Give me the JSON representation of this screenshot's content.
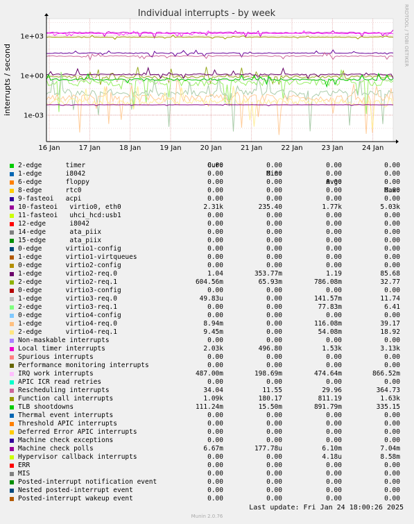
{
  "chart_data": {
    "type": "line",
    "title": "Individual interrupts - by week",
    "ylabel": "interrupts / second",
    "yscale": "log",
    "yticks": [
      "1e-03",
      "1e+00",
      "1e+03"
    ],
    "ylim": [
      1e-05,
      20000
    ],
    "x_ticks": [
      "16 Jan",
      "17 Jan",
      "18 Jan",
      "19 Jan",
      "20 Jan",
      "21 Jan",
      "22 Jan",
      "23 Jan",
      "24 Jan"
    ],
    "grid": true,
    "series": [
      {
        "name": "10-fasteoi virtio0, eth0",
        "color": "#cc00cc",
        "level": 1770,
        "low": 600,
        "high": 3000
      },
      {
        "name": "Local timer interrupts",
        "color": "#ff33ff",
        "level": 1530,
        "low": 900,
        "high": 2500
      },
      {
        "name": "Function call interrupts",
        "color": "#999900",
        "level": 811,
        "low": 500,
        "high": 1200
      },
      {
        "name": "TLB shootdowns",
        "color": "#660099",
        "level": 50,
        "low": 25,
        "high": 90
      },
      {
        "name": "Rescheduling interrupts",
        "color": "#cc6699",
        "level": 30,
        "low": 15,
        "high": 60
      },
      {
        "name": "2-edge virtio2-req.1",
        "color": "#99aa22",
        "level": 0.786,
        "low": 0.2,
        "high": 6
      },
      {
        "name": "1-edge virtio2-req.0",
        "color": "#660066",
        "level": 1.19,
        "low": 0.6,
        "high": 4
      },
      {
        "name": "2-edge virtio3-req.1",
        "color": "#99ee66",
        "level": 0.3,
        "low": 0.0001,
        "high": 3
      },
      {
        "name": "1-edge virtio3-req.0",
        "color": "#aaccaa",
        "level": 0.05,
        "low": 5e-05,
        "high": 2
      },
      {
        "name": "1-edge virtio4-req.0",
        "color": "#ffcc99",
        "level": 0.02,
        "low": 3e-05,
        "high": 1
      },
      {
        "name": "2-edge virtio4-req.1",
        "color": "#ffee99",
        "level": 0.01,
        "low": 3e-05,
        "high": 1
      },
      {
        "name": "Machine check polls",
        "color": "#880088",
        "level": 0.0061,
        "low": 0.005,
        "high": 0.007
      },
      {
        "name": "IRQ work interrupts",
        "color": "#ffccff",
        "level": 0.47,
        "low": 0.2,
        "high": 0.86
      },
      {
        "name": "2-edge timer",
        "color": "#00cc00",
        "level": 0.5,
        "low": 0.1,
        "high": 1.5
      }
    ]
  },
  "side_label": "RRDTOOL / TOBI OETIKER",
  "legend": {
    "headers": [
      "Cur:",
      "Min:",
      "Avg:",
      "Max:"
    ],
    "rows": [
      {
        "name": "2-edge      timer",
        "color": "#00cc00",
        "cur": "0.00",
        "min": "0.00",
        "avg": "0.00",
        "max": "0.00"
      },
      {
        "name": "1-edge      i8042",
        "color": "#0066b3",
        "cur": "0.00",
        "min": "0.00",
        "avg": "0.00",
        "max": "0.00"
      },
      {
        "name": "6-edge      floppy",
        "color": "#ff8000",
        "cur": "0.00",
        "min": "0.00",
        "avg": "0.00",
        "max": "0.00"
      },
      {
        "name": "8-edge      rtc0",
        "color": "#ffcc00",
        "cur": "0.00",
        "min": "0.00",
        "avg": "0.00",
        "max": "0.00"
      },
      {
        "name": "9-fasteoi   acpi",
        "color": "#330099",
        "cur": "0.00",
        "min": "0.00",
        "avg": "0.00",
        "max": "0.00"
      },
      {
        "name": "10-fasteoi   virtio0, eth0",
        "color": "#990099",
        "cur": "2.31k",
        "min": "235.40",
        "avg": "1.77k",
        "max": "5.03k"
      },
      {
        "name": "11-fasteoi   uhci_hcd:usb1",
        "color": "#ccff00",
        "cur": "0.00",
        "min": "0.00",
        "avg": "0.00",
        "max": "0.00"
      },
      {
        "name": "12-edge      i8042",
        "color": "#ff0000",
        "cur": "0.00",
        "min": "0.00",
        "avg": "0.00",
        "max": "0.00"
      },
      {
        "name": "14-edge      ata_piix",
        "color": "#808080",
        "cur": "0.00",
        "min": "0.00",
        "avg": "0.00",
        "max": "0.00"
      },
      {
        "name": "15-edge      ata_piix",
        "color": "#008f00",
        "cur": "0.00",
        "min": "0.00",
        "avg": "0.00",
        "max": "0.00"
      },
      {
        "name": "0-edge      virtio1-config",
        "color": "#00487d",
        "cur": "0.00",
        "min": "0.00",
        "avg": "0.00",
        "max": "0.00"
      },
      {
        "name": "1-edge      virtio1-virtqueues",
        "color": "#b35a00",
        "cur": "0.00",
        "min": "0.00",
        "avg": "0.00",
        "max": "0.00"
      },
      {
        "name": "0-edge      virtio2-config",
        "color": "#b38f00",
        "cur": "0.00",
        "min": "0.00",
        "avg": "0.00",
        "max": "0.00"
      },
      {
        "name": "1-edge      virtio2-req.0",
        "color": "#6b006b",
        "cur": "1.04",
        "min": "353.77m",
        "avg": "1.19",
        "max": "85.68"
      },
      {
        "name": "2-edge      virtio2-req.1",
        "color": "#8fb300",
        "cur": "604.56m",
        "min": "65.93m",
        "avg": "786.08m",
        "max": "32.77"
      },
      {
        "name": "0-edge      virtio3-config",
        "color": "#b30000",
        "cur": "0.00",
        "min": "0.00",
        "avg": "0.00",
        "max": "0.00"
      },
      {
        "name": "1-edge      virtio3-req.0",
        "color": "#bebebe",
        "cur": "49.83u",
        "min": "0.00",
        "avg": "141.57m",
        "max": "11.74"
      },
      {
        "name": "2-edge      virtio3-req.1",
        "color": "#80ff80",
        "cur": "0.00",
        "min": "0.00",
        "avg": "77.83m",
        "max": "6.41"
      },
      {
        "name": "0-edge      virtio4-config",
        "color": "#80c9ff",
        "cur": "0.00",
        "min": "0.00",
        "avg": "0.00",
        "max": "0.00"
      },
      {
        "name": "1-edge      virtio4-req.0",
        "color": "#ffc080",
        "cur": "8.94m",
        "min": "0.00",
        "avg": "116.08m",
        "max": "39.17"
      },
      {
        "name": "2-edge      virtio4-req.1",
        "color": "#ffe680",
        "cur": "9.45m",
        "min": "0.00",
        "avg": "54.08m",
        "max": "18.92"
      },
      {
        "name": "Non-maskable interrupts",
        "color": "#aa80ff",
        "cur": "0.00",
        "min": "0.00",
        "avg": "0.00",
        "max": "0.00"
      },
      {
        "name": "Local timer interrupts",
        "color": "#ee00cc",
        "cur": "2.03k",
        "min": "496.80",
        "avg": "1.53k",
        "max": "3.13k"
      },
      {
        "name": "Spurious interrupts",
        "color": "#ff8080",
        "cur": "0.00",
        "min": "0.00",
        "avg": "0.00",
        "max": "0.00"
      },
      {
        "name": "Performance monitoring interrupts",
        "color": "#666600",
        "cur": "0.00",
        "min": "0.00",
        "avg": "0.00",
        "max": "0.00"
      },
      {
        "name": "IRQ work interrupts",
        "color": "#ffbfff",
        "cur": "487.00m",
        "min": "198.69m",
        "avg": "474.64m",
        "max": "866.52m"
      },
      {
        "name": "APIC ICR read retries",
        "color": "#00ffcc",
        "cur": "0.00",
        "min": "0.00",
        "avg": "0.00",
        "max": "0.00"
      },
      {
        "name": "Rescheduling interrupts",
        "color": "#cc6699",
        "cur": "34.04",
        "min": "11.55",
        "avg": "29.96",
        "max": "364.73"
      },
      {
        "name": "Function call interrupts",
        "color": "#999900",
        "cur": "1.09k",
        "min": "180.17",
        "avg": "811.19",
        "max": "1.63k"
      },
      {
        "name": "TLB shootdowns",
        "color": "#00cc00",
        "cur": "111.24m",
        "min": "15.50m",
        "avg": "891.79m",
        "max": "335.15"
      },
      {
        "name": "Thermal event interrupts",
        "color": "#0066b3",
        "cur": "0.00",
        "min": "0.00",
        "avg": "0.00",
        "max": "0.00"
      },
      {
        "name": "Threshold APIC interrupts",
        "color": "#ff8000",
        "cur": "0.00",
        "min": "0.00",
        "avg": "0.00",
        "max": "0.00"
      },
      {
        "name": "Deferred Error APIC interrupts",
        "color": "#ffcc00",
        "cur": "0.00",
        "min": "0.00",
        "avg": "0.00",
        "max": "0.00"
      },
      {
        "name": "Machine check exceptions",
        "color": "#330099",
        "cur": "0.00",
        "min": "0.00",
        "avg": "0.00",
        "max": "0.00"
      },
      {
        "name": "Machine check polls",
        "color": "#990099",
        "cur": "6.67m",
        "min": "177.78u",
        "avg": "6.10m",
        "max": "7.04m"
      },
      {
        "name": "Hypervisor callback interrupts",
        "color": "#ccff00",
        "cur": "0.00",
        "min": "0.00",
        "avg": "4.18u",
        "max": "8.58m"
      },
      {
        "name": "ERR",
        "color": "#ff0000",
        "cur": "0.00",
        "min": "0.00",
        "avg": "0.00",
        "max": "0.00"
      },
      {
        "name": "MIS",
        "color": "#808080",
        "cur": "0.00",
        "min": "0.00",
        "avg": "0.00",
        "max": "0.00"
      },
      {
        "name": "Posted-interrupt notification event",
        "color": "#008f00",
        "cur": "0.00",
        "min": "0.00",
        "avg": "0.00",
        "max": "0.00"
      },
      {
        "name": "Nested posted-interrupt event",
        "color": "#00487d",
        "cur": "0.00",
        "min": "0.00",
        "avg": "0.00",
        "max": "0.00"
      },
      {
        "name": "Posted-interrupt wakeup event",
        "color": "#b35a00",
        "cur": "0.00",
        "min": "0.00",
        "avg": "0.00",
        "max": "0.00"
      }
    ]
  },
  "footer": {
    "last_update": "Last update: Fri Jan 24 18:00:26 2025",
    "munin": "Munin 2.0.76"
  }
}
